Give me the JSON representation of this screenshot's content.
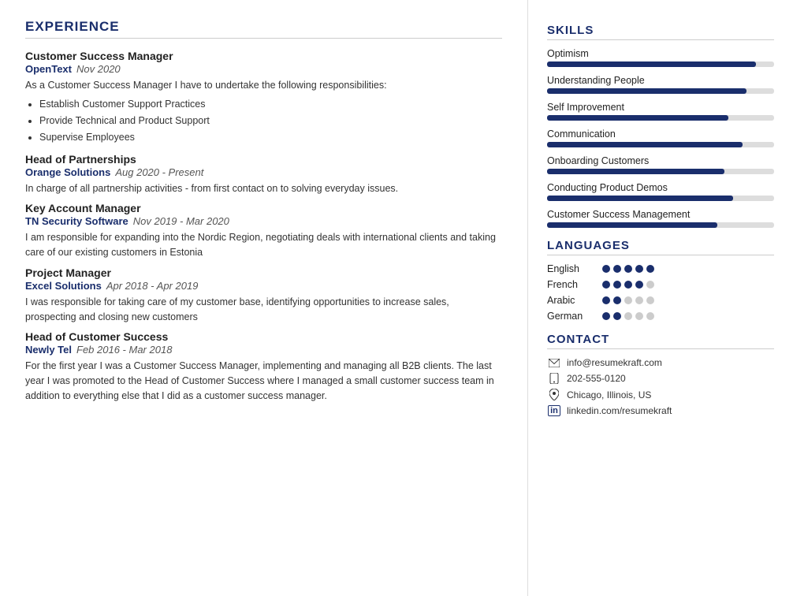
{
  "left": {
    "section_title": "EXPERIENCE",
    "jobs": [
      {
        "title": "Customer Success Manager",
        "company": "OpenText",
        "date": "Nov 2020",
        "desc": "As a Customer Success Manager I have to undertake the following responsibilities:",
        "bullets": [
          "Establish Customer Support Practices",
          "Provide Technical and Product Support",
          "Supervise Employees"
        ]
      },
      {
        "title": "Head of Partnerships",
        "company": "Orange Solutions",
        "date": "Aug 2020 - Present",
        "desc": "In charge of all partnership activities - from first contact on to solving everyday issues.",
        "bullets": []
      },
      {
        "title": "Key Account Manager",
        "company": "TN Security Software",
        "date": "Nov 2019 - Mar 2020",
        "desc": "I am responsible for expanding into the Nordic Region, negotiating deals with international clients and taking care of our existing customers in Estonia",
        "bullets": []
      },
      {
        "title": "Project Manager",
        "company": "Excel Solutions",
        "date": "Apr 2018 - Apr 2019",
        "desc": "I was responsible for taking care of my customer base, identifying opportunities to increase sales, prospecting and closing new customers",
        "bullets": []
      },
      {
        "title": "Head of Customer Success",
        "company": "Newly Tel",
        "date": "Feb 2016 - Mar 2018",
        "desc": "For the first year I was a Customer Success Manager, implementing and managing all B2B clients. The last year I was promoted to the Head of Customer Success where I managed a small customer success team in addition to everything else that I did as a customer success manager.",
        "bullets": []
      }
    ]
  },
  "right": {
    "skills_title": "SKILLS",
    "skills": [
      {
        "label": "Optimism",
        "pct": 92
      },
      {
        "label": "Understanding People",
        "pct": 88
      },
      {
        "label": "Self Improvement",
        "pct": 80
      },
      {
        "label": "Communication",
        "pct": 86
      },
      {
        "label": "Onboarding Customers",
        "pct": 78
      },
      {
        "label": "Conducting Product Demos",
        "pct": 82
      },
      {
        "label": "Customer Success Management",
        "pct": 75
      }
    ],
    "languages_title": "LANGUAGES",
    "languages": [
      {
        "name": "English",
        "filled": 5,
        "empty": 0
      },
      {
        "name": "French",
        "filled": 4,
        "empty": 1
      },
      {
        "name": "Arabic",
        "filled": 2,
        "empty": 3
      },
      {
        "name": "German",
        "filled": 2,
        "empty": 3
      }
    ],
    "contact_title": "CONTACT",
    "contacts": [
      {
        "icon": "✉",
        "text": "info@resumekraft.com",
        "type": "email"
      },
      {
        "icon": "📱",
        "text": "202-555-0120",
        "type": "phone"
      },
      {
        "icon": "📍",
        "text": "Chicago, Illinois, US",
        "type": "location"
      },
      {
        "icon": "in",
        "text": "linkedin.com/resumekraft",
        "type": "linkedin"
      }
    ]
  }
}
